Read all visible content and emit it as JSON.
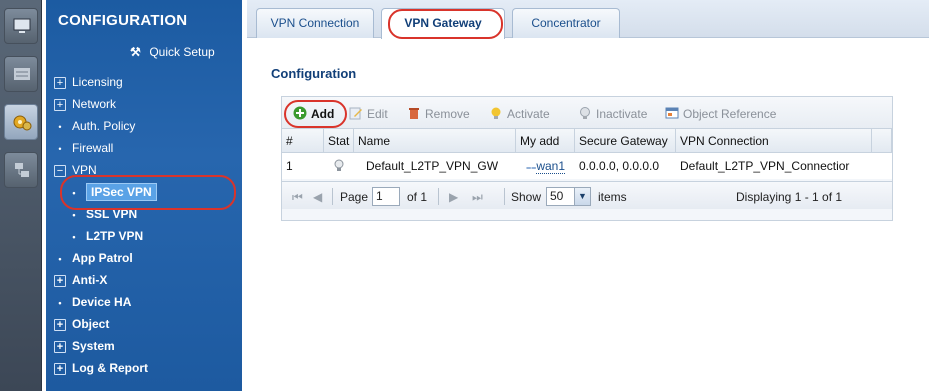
{
  "sidebar_strip": {
    "buttons": [
      {
        "icon": "monitor-icon",
        "active": false
      },
      {
        "icon": "stats-icon",
        "active": false
      },
      {
        "icon": "gears-icon",
        "active": true
      },
      {
        "icon": "flowchart-icon",
        "active": false
      }
    ]
  },
  "nav": {
    "title": "CONFIGURATION",
    "quick_setup": "Quick Setup",
    "items": [
      {
        "label": "Licensing",
        "marker": "⊞"
      },
      {
        "label": "Network",
        "marker": "⊞"
      },
      {
        "label": "Auth. Policy",
        "marker": "•"
      },
      {
        "label": "Firewall",
        "marker": "•"
      },
      {
        "label": "VPN",
        "marker": "⊟"
      },
      {
        "label": "IPSec VPN",
        "marker": "•"
      },
      {
        "label": "SSL VPN",
        "marker": "•"
      },
      {
        "label": "L2TP VPN",
        "marker": "•"
      },
      {
        "label": "App Patrol",
        "marker": "•"
      },
      {
        "label": "Anti-X",
        "marker": "⊞"
      },
      {
        "label": "Device HA",
        "marker": "•"
      },
      {
        "label": "Object",
        "marker": "⊞"
      },
      {
        "label": "System",
        "marker": "⊞"
      },
      {
        "label": "Log & Report",
        "marker": "⊞"
      }
    ]
  },
  "tabs": [
    {
      "label": "VPN Connection"
    },
    {
      "label": "VPN Gateway"
    },
    {
      "label": "Concentrator"
    }
  ],
  "main": {
    "section_title": "Configuration",
    "toolbar": {
      "add": "Add",
      "edit": "Edit",
      "remove": "Remove",
      "activate": "Activate",
      "inactivate": "Inactivate",
      "object_reference": "Object Reference"
    },
    "table": {
      "columns": [
        "#",
        "Stat",
        "Name",
        "My add",
        "Secure Gateway",
        "VPN Connection"
      ],
      "rows": [
        {
          "num": "1",
          "status_icon": "bulb-icon",
          "name": "Default_L2TP_VPN_GW",
          "my_address": "wan1",
          "secure_gateway": "0.0.0.0, 0.0.0.0",
          "vpn_connection": "Default_L2TP_VPN_Connectior"
        }
      ]
    },
    "pager": {
      "page_label": "Page",
      "page_value": "1",
      "of_label": "of 1",
      "show_label": "Show",
      "show_value": "50",
      "items_label": "items",
      "displaying": "Displaying 1 - 1 of 1"
    }
  },
  "colors": {
    "nav_bg": "#2766ae",
    "accent": "#113f78",
    "highlight": "#d9342b",
    "selected_item": "#5aa2e6"
  }
}
